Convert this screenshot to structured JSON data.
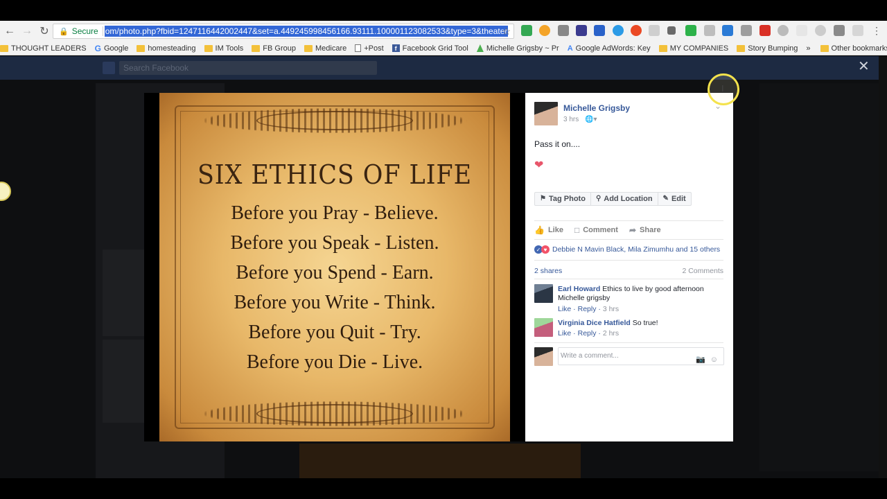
{
  "browser": {
    "secure_label": "Secure",
    "url": "om/photo.php?fbid=1247116442002447&set=a.449245998456166.93111.100001123082533&type=3&theater",
    "more_bookmarks": "»",
    "other_bookmarks": "Other bookmarks",
    "bookmarks": [
      {
        "label": "THOUGHT LEADERS",
        "icon": "folder-icon"
      },
      {
        "label": "Google",
        "icon": "google-icon"
      },
      {
        "label": "homesteading",
        "icon": "folder-icon"
      },
      {
        "label": "IM Tools",
        "icon": "folder-icon"
      },
      {
        "label": "FB Group",
        "icon": "folder-icon"
      },
      {
        "label": "Medicare",
        "icon": "folder-icon"
      },
      {
        "label": "+Post",
        "icon": "page-icon"
      },
      {
        "label": "Facebook Grid Tool",
        "icon": "facebook-icon"
      },
      {
        "label": "Michelle Grigsby ~ Pr",
        "icon": "site-icon"
      },
      {
        "label": "Google AdWords: Key",
        "icon": "adwords-icon"
      },
      {
        "label": "MY COMPANIES",
        "icon": "folder-icon"
      },
      {
        "label": "Story Bumping",
        "icon": "folder-icon"
      }
    ]
  },
  "facebook": {
    "search_placeholder": "Search Facebook"
  },
  "poster": {
    "title": "SIX ETHICS OF LIFE",
    "lines": [
      "Before you Pray - Believe.",
      "Before you Speak - Listen.",
      "Before you Spend - Earn.",
      "Before you Write - Think.",
      "Before you Quit - Try.",
      "Before you Die - Live."
    ]
  },
  "post": {
    "author": "Michelle Grigsby",
    "time": "3 hrs",
    "privacy_icon": "globe-icon",
    "caption": "Pass it on....",
    "buttons": {
      "tag": "Tag Photo",
      "location": "Add Location",
      "edit": "Edit"
    },
    "actions": {
      "like": "Like",
      "comment": "Comment",
      "share": "Share"
    },
    "reactions_text": "Debbie N Mavin Black, Mila Zimumhu and 15 others",
    "shares": "2 shares",
    "comments_count": "2 Comments",
    "comments": [
      {
        "author": "Earl Howard",
        "text": "Ethics to live by good afternoon Michelle grigsby",
        "like": "Like",
        "reply": "Reply",
        "time": "3 hrs"
      },
      {
        "author": "Virginia Dice Hatfield",
        "text": "So true!",
        "like": "Like",
        "reply": "Reply",
        "time": "2 hrs"
      }
    ],
    "compose_placeholder": "Write a comment..."
  },
  "colors": {
    "fb_blue": "#365899",
    "heart": "#e8566b"
  }
}
